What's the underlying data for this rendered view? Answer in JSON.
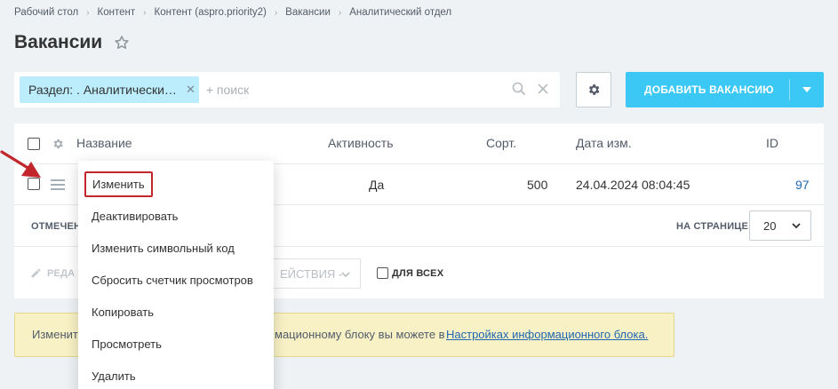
{
  "breadcrumb": [
    "Рабочий стол",
    "Контент",
    "Контент (aspro.priority2)",
    "Вакансии",
    "Аналитический отдел"
  ],
  "page_title": "Вакансии",
  "filter": {
    "chip_label": "Раздел: . Аналитически…",
    "search_placeholder": "+ поиск"
  },
  "add_button": {
    "label": "ДОБАВИТЬ ВАКАНСИЮ"
  },
  "table": {
    "columns": [
      "Название",
      "Активность",
      "Сорт.",
      "Дата изм.",
      "ID"
    ],
    "row": {
      "active": "Да",
      "sort": "500",
      "date": "24.04.2024 08:04:45",
      "id": "97"
    }
  },
  "footer": {
    "marked_label": "ОТМЕЧЕН",
    "per_page_label": "НА СТРАНИЦЕ:",
    "per_page_value": "20"
  },
  "action_bar": {
    "edit_label": "РЕДА",
    "actions_label": "ЕЙСТВИЯ -",
    "for_all_label": "ДЛЯ ВСЕХ"
  },
  "notice": {
    "text_start": "Изменит",
    "text_mid": "мационному блоку вы можете в",
    "link": "Настройках информационного блока."
  },
  "context_menu": {
    "items": [
      "Изменить",
      "Деактивировать",
      "Изменить символьный код",
      "Сбросить счетчик просмотров",
      "Копировать",
      "Просмотреть",
      "Удалить"
    ]
  },
  "colors": {
    "accent": "#3bc8f5",
    "chip_bg": "#bcedfc",
    "highlight": "#c2262b",
    "notice_bg": "#f8f1c5"
  }
}
